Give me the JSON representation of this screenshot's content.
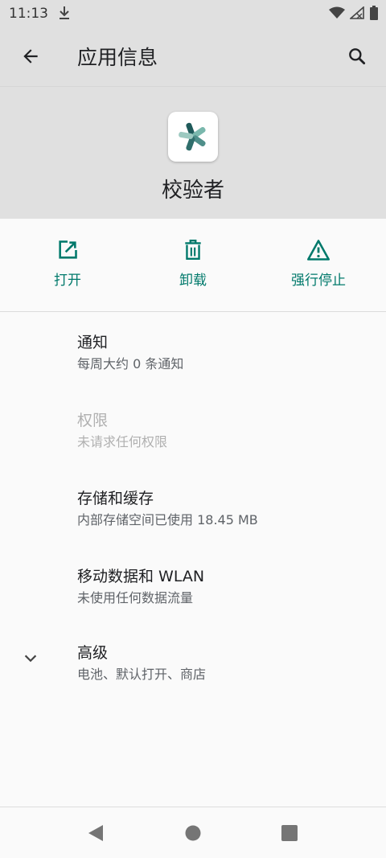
{
  "status_bar": {
    "time": "11:13"
  },
  "toolbar": {
    "title": "应用信息"
  },
  "app": {
    "name": "校验者"
  },
  "actions": [
    {
      "label": "打开",
      "icon": "open-in-new-icon"
    },
    {
      "label": "卸载",
      "icon": "trash-icon"
    },
    {
      "label": "强行停止",
      "icon": "warning-icon"
    }
  ],
  "list": {
    "notifications": {
      "title": "通知",
      "subtitle": "每周大约 0 条通知"
    },
    "permissions": {
      "title": "权限",
      "subtitle": "未请求任何权限"
    },
    "storage": {
      "title": "存储和缓存",
      "subtitle": "内部存储空间已使用 18.45 MB"
    },
    "mobile_data": {
      "title": "移动数据和 WLAN",
      "subtitle": "未使用任何数据流量"
    },
    "advanced": {
      "title": "高级",
      "subtitle": "电池、默认打开、商店"
    }
  },
  "colors": {
    "accent": "#00796b",
    "header_bg": "#e0e0e0",
    "body_bg": "#fafafa"
  }
}
